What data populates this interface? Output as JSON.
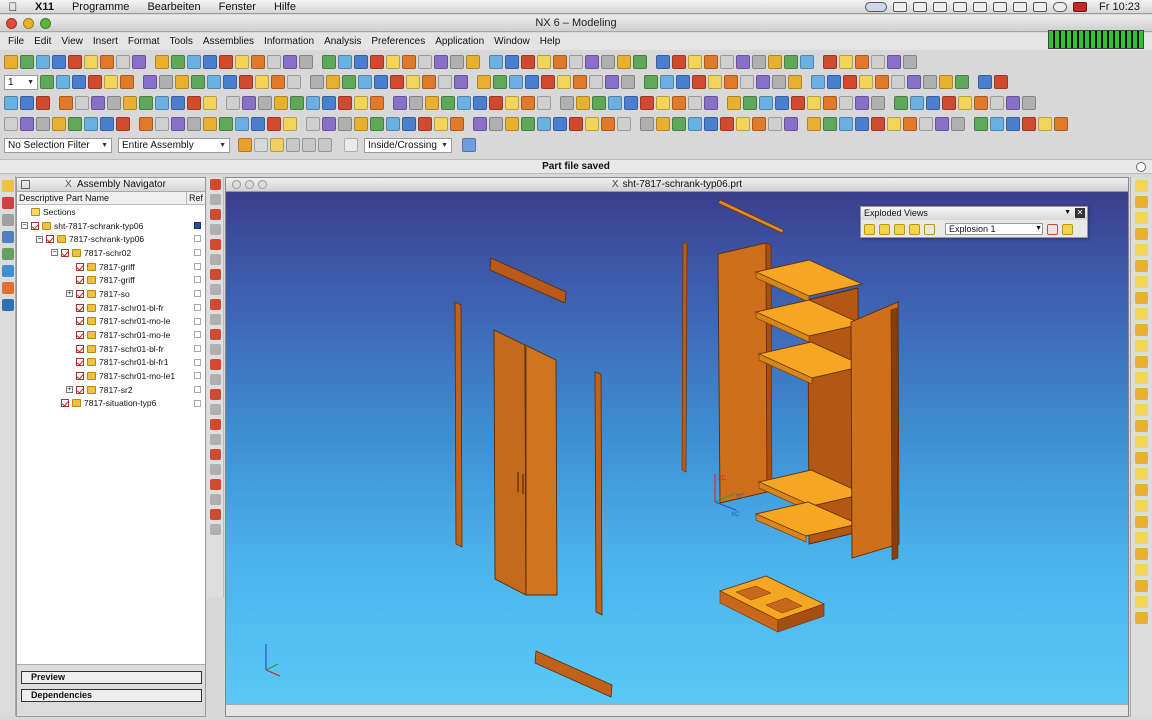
{
  "mac_menu": {
    "apple": "",
    "app": "X11",
    "items": [
      "Programme",
      "Bearbeiten",
      "Fenster",
      "Hilfe"
    ],
    "clock": "Fr 10:23"
  },
  "window": {
    "title": "NX 6 – Modeling"
  },
  "menu": [
    "File",
    "Edit",
    "View",
    "Insert",
    "Format",
    "Tools",
    "Assemblies",
    "Information",
    "Analysis",
    "Preferences",
    "Application",
    "Window",
    "Help"
  ],
  "toolbar2": {
    "layer_value": "1"
  },
  "selection": {
    "filter": "No Selection Filter",
    "scope": "Entire Assembly",
    "mode": "Inside/Crossing"
  },
  "status": {
    "message": "Part file saved"
  },
  "navigator": {
    "title": "Assembly Navigator",
    "close_glyph": "X",
    "col_part": "Descriptive Part Name",
    "col_ref": "Ref",
    "rows": [
      {
        "label": "Sections",
        "level": 0,
        "type": "folder",
        "check": false,
        "toggle": ""
      },
      {
        "label": "sht-7817-schrank-typ06",
        "level": 0,
        "type": "asm",
        "check": true,
        "toggle": "-"
      },
      {
        "label": "7817-schrank-typ06",
        "level": 1,
        "type": "asm",
        "check": true,
        "toggle": "-"
      },
      {
        "label": "7817-schr02",
        "level": 2,
        "type": "asm",
        "check": true,
        "toggle": "-"
      },
      {
        "label": "7817-griff",
        "level": 3,
        "type": "part",
        "check": true,
        "toggle": ""
      },
      {
        "label": "7817-griff",
        "level": 3,
        "type": "part",
        "check": true,
        "toggle": ""
      },
      {
        "label": "7817-so",
        "level": 3,
        "type": "asm",
        "check": true,
        "toggle": "+"
      },
      {
        "label": "7817-schr01-bl-fr",
        "level": 3,
        "type": "part",
        "check": true,
        "toggle": ""
      },
      {
        "label": "7817-schr01-mo-le",
        "level": 3,
        "type": "part",
        "check": true,
        "toggle": ""
      },
      {
        "label": "7817-schr01-mo-le",
        "level": 3,
        "type": "part",
        "check": true,
        "toggle": ""
      },
      {
        "label": "7817-schr01-bl-fr",
        "level": 3,
        "type": "part",
        "check": true,
        "toggle": ""
      },
      {
        "label": "7817-schr01-bl-fr1",
        "level": 3,
        "type": "part",
        "check": true,
        "toggle": ""
      },
      {
        "label": "7817-schr01-mo-le1",
        "level": 3,
        "type": "part",
        "check": true,
        "toggle": ""
      },
      {
        "label": "7817-sr2",
        "level": 3,
        "type": "asm",
        "check": true,
        "toggle": "+"
      },
      {
        "label": "7817-situation-typ6",
        "level": 2,
        "type": "part",
        "check": true,
        "toggle": ""
      }
    ],
    "preview_label": "Preview",
    "dependencies_label": "Dependencies"
  },
  "viewport": {
    "title": "sht-7817-schrank-typ06.prt",
    "close_glyph": "X",
    "axis_xc": "XC",
    "axis_yc": "YC",
    "axis_zc": "ZC"
  },
  "exploded_views": {
    "title": "Exploded Views",
    "selected": "Explosion 1"
  },
  "colors": {
    "wood_dark": "#c8681a",
    "wood_light": "#f5a623",
    "viewport_top": "#3a3f8e",
    "viewport_bottom": "#59c9f6"
  }
}
